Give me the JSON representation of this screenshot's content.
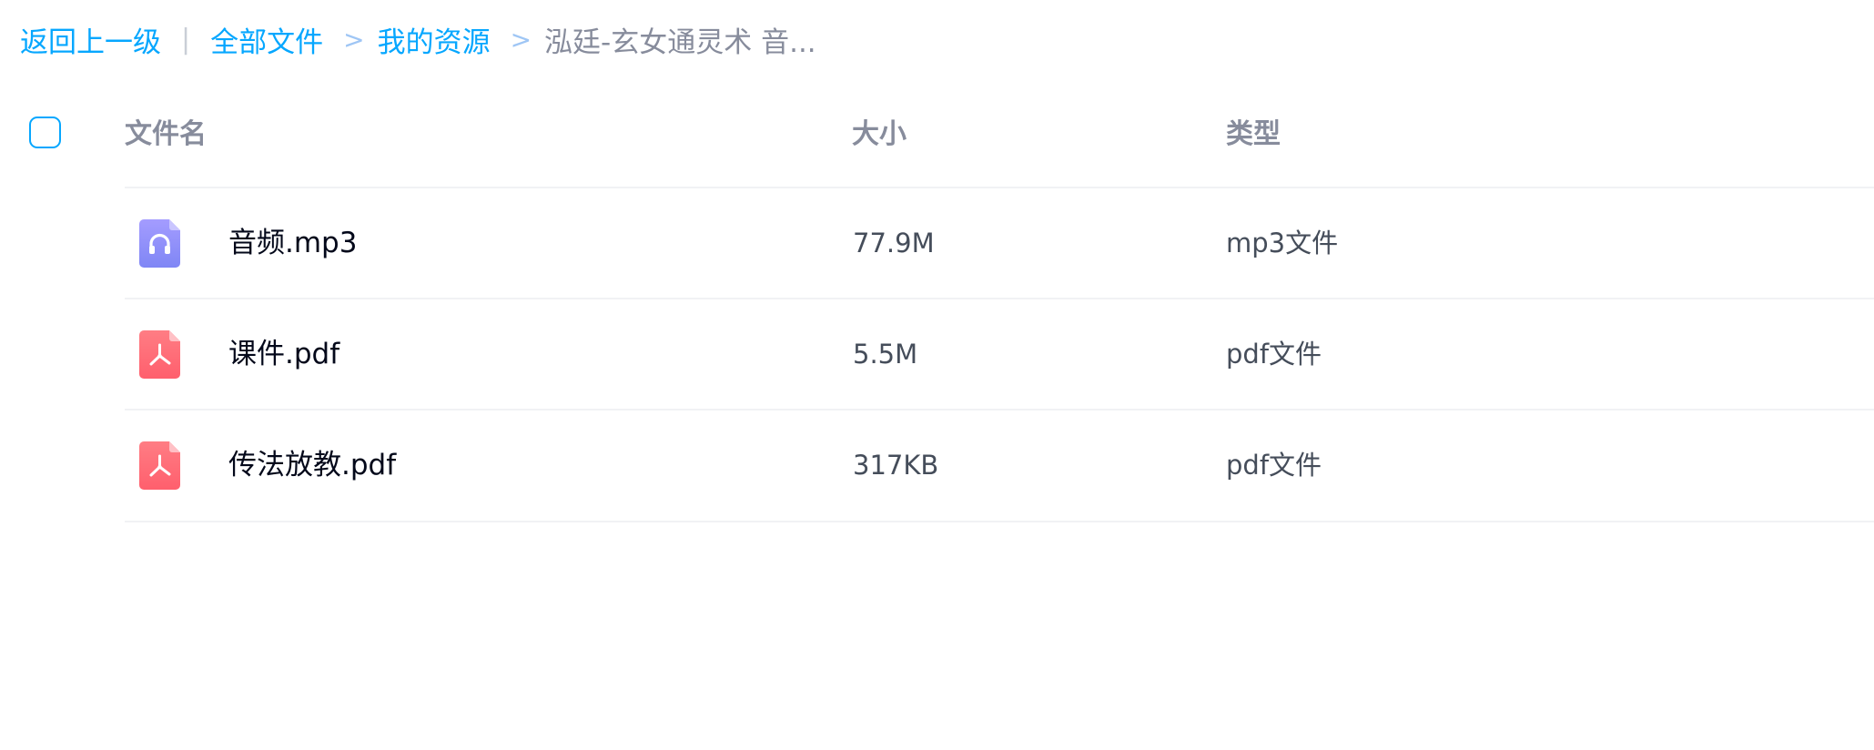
{
  "breadcrumb": {
    "back_label": "返回上一级",
    "separator_bar": "|",
    "separator": ">",
    "items": [
      "全部文件",
      "我的资源"
    ],
    "current": "泓廷-玄女通灵术 音..."
  },
  "table": {
    "headers": {
      "name": "文件名",
      "size": "大小",
      "type": "类型"
    },
    "rows": [
      {
        "name": "音频.mp3",
        "size": "77.9M",
        "type": "mp3文件",
        "icon": "audio-file-icon"
      },
      {
        "name": "课件.pdf",
        "size": "5.5M",
        "type": "pdf文件",
        "icon": "pdf-file-icon"
      },
      {
        "name": "传法放教.pdf",
        "size": "317KB",
        "type": "pdf文件",
        "icon": "pdf-file-icon"
      }
    ]
  },
  "colors": {
    "accent": "#06a7ff",
    "audio_icon": "#8c8cff",
    "pdf_icon": "#ff6b78",
    "header_text": "#878c9c",
    "row_text": "#03081a"
  }
}
